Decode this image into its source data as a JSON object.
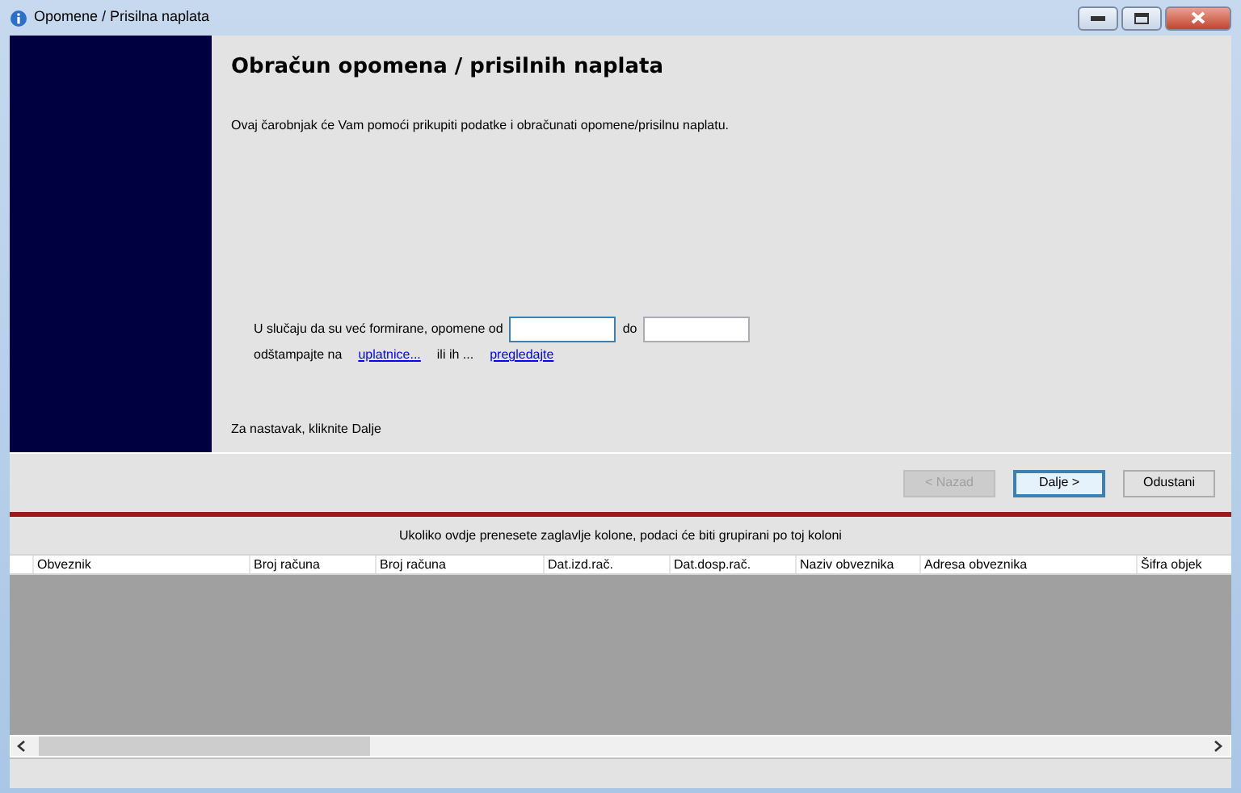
{
  "window": {
    "title": "Opomene / Prisilna naplata"
  },
  "wizard": {
    "heading": "Obračun opomena / prisilnih naplata",
    "intro": "Ovaj čarobnjak će Vam pomoći prikupiti podatke i obračunati opomene/prisilnu naplatu.",
    "range_label": "U slučaju da su već formirane, opomene od",
    "range_from": {
      "focused": true
    },
    "range_sep": "do",
    "range_to": {
      "focused": false
    },
    "print_label": "odštampajte na",
    "print_link": "uplatnice...",
    "or_label": "ili ih ...",
    "preview_link": "pregledajte",
    "footer": "Za nastavak, kliknite Dalje"
  },
  "buttons": [
    {
      "label": "< Nazad",
      "disabled": true,
      "focused": false
    },
    {
      "label": "Dalje >",
      "disabled": false,
      "focused": true
    },
    {
      "label": "Odustani",
      "disabled": false,
      "focused": false
    }
  ],
  "grid": {
    "group_hint": "Ukoliko ovdje prenesete zaglavlje kolone, podaci će biti grupirani po toj koloni",
    "columns": [
      "Obveznik",
      "Broj računa",
      "Broj računa",
      "Dat.izd.rač.",
      "Dat.dosp.rač.",
      "Naziv obveznika",
      "Adresa obveznika",
      "Šifra objek"
    ]
  }
}
